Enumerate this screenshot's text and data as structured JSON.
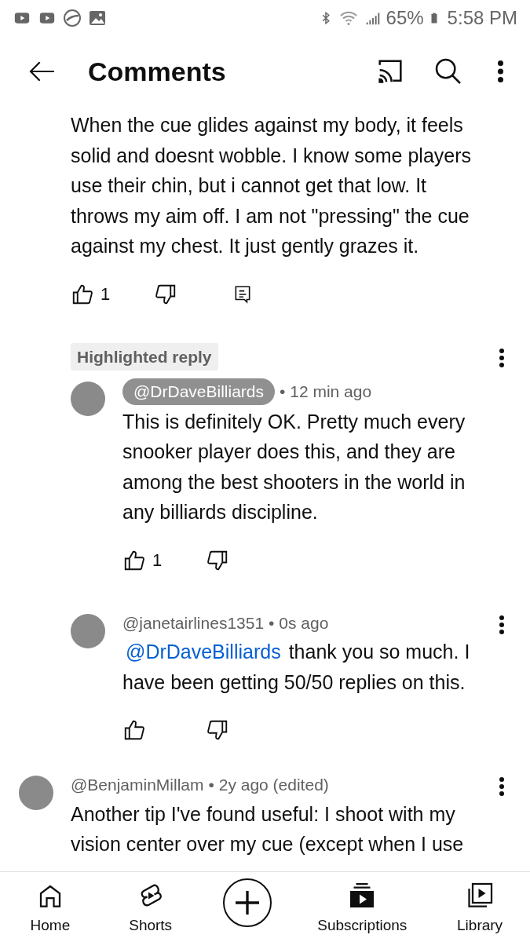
{
  "status_bar": {
    "battery": "65%",
    "time": "5:58 PM"
  },
  "header": {
    "title": "Comments"
  },
  "comments": [
    {
      "kind": "continuation",
      "text": "When the cue glides against my body, it feels solid and doesnt wobble. I know some players use their chin, but i cannot get that low. It throws my aim off. I am not \"pressing\" the cue against my chest. It just gently grazes it.",
      "likes": "1",
      "reply_button": true
    },
    {
      "kind": "reply",
      "badge": "Highlighted reply",
      "author": "@DrDaveBilliards",
      "author_highlighted": true,
      "time": "• 12 min ago",
      "text": "This is definitely OK.  Pretty much every snooker player does this, and they are among the best shooters in the world in any billiards discipline.",
      "likes": "1"
    },
    {
      "kind": "reply",
      "author": "@janetairlines1351",
      "author_highlighted": false,
      "time": "• 0s ago",
      "mention": "@DrDaveBilliards",
      "text": "thank you so much. I have been getting 50/50 replies on this."
    },
    {
      "kind": "comment",
      "author": "@BenjaminMillam",
      "author_highlighted": false,
      "time": "• 2y ago (edited)",
      "text": "Another tip I've found useful: I shoot with my vision center over my cue (except when I use"
    }
  ],
  "bottom_nav": [
    {
      "kind": "home",
      "label": "Home"
    },
    {
      "kind": "shorts",
      "label": "Shorts"
    },
    {
      "kind": "create"
    },
    {
      "kind": "subscriptions",
      "label": "Subscriptions"
    },
    {
      "kind": "library",
      "label": "Library"
    }
  ]
}
